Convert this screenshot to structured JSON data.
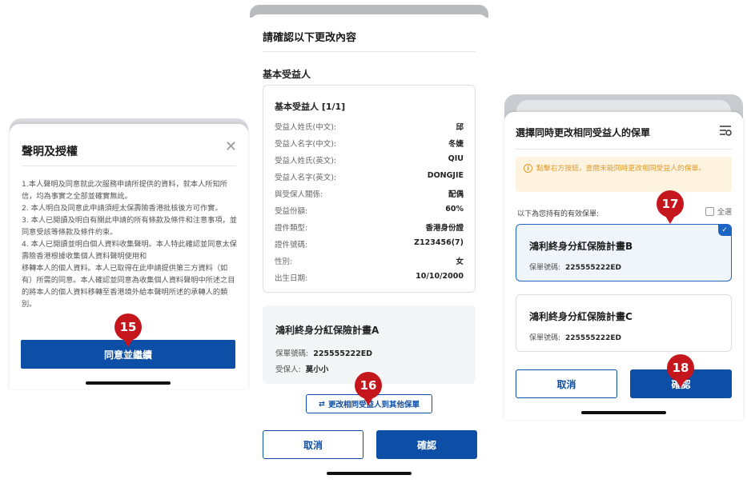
{
  "panel1": {
    "title": "聲明及授權",
    "close_icon": "close-icon",
    "paragraphs": [
      "1.本人聲明及同意就此次服務申請所提供的資料，就本人所知所信，均為事實之全部並確實無訛。",
      "2. 本人明白及同意此申請須經太保壽險香港批核後方可作實。",
      "3. 本人已閱讀及明白有關此申請的所有條款及條件和注意事項，並同意受該等條款及條件約束。",
      "4. 本人已閱讀並明白個人資料收集聲明。本人特此確認並同意太保壽險香港根據收集個人資料聲明使用和",
      "移轉本人的個人資料。本人已取得在此申請提供第三方資料（如有）所需的同意。本人確認並同意為收集個人資料聲明中所述之目的將本人的個人資料移轉至香港境外給本聲明所述的承轉人的類別。"
    ],
    "agree_button": "同意並繼續",
    "step": "15"
  },
  "panel2": {
    "title": "請確認以下更改內容",
    "section_title": "基本受益人",
    "card_title": "基本受益人 [1/1]",
    "fields": [
      {
        "label": "受益人姓氏(中文):",
        "value": "邱"
      },
      {
        "label": "受益人名字(中文):",
        "value": "冬婕"
      },
      {
        "label": "受益人姓氏(英文):",
        "value": "QIU"
      },
      {
        "label": "受益人名字(英文):",
        "value": "DONGJIE"
      },
      {
        "label": "與受保人關係:",
        "value": "配偶"
      },
      {
        "label": "受益份額:",
        "value": "60%"
      },
      {
        "label": "證件類型:",
        "value": "香港身份證"
      },
      {
        "label": "證件號碼:",
        "value": "Z123456(7)"
      },
      {
        "label": "性別:",
        "value": "女"
      },
      {
        "label": "出生日期:",
        "value": "10/10/2000"
      }
    ],
    "plan": {
      "name": "鴻利終身分紅保險計畫A",
      "policy_label": "保單號碼:",
      "policy_no": "225555222ED",
      "insured_label": "受保人:",
      "insured": "莫小小"
    },
    "change_link": "更改相同受益人到其他保單",
    "cancel": "取消",
    "confirm": "確認",
    "step": "16"
  },
  "panel3": {
    "title": "選擇同時更改相同受益人的保單",
    "notice": "點擊右方按鈕，查閱未能同時更改相同受益人的保單。",
    "holding_label": "以下為您持有的有效保單:",
    "select_all": "全選",
    "policies": [
      {
        "name": "鴻利終身分紅保險計畫B",
        "label": "保單號碼:",
        "number": "225555222ED",
        "selected": true
      },
      {
        "name": "鴻利終身分紅保險計畫C",
        "label": "保單號碼:",
        "number": "225555222ED",
        "selected": false
      }
    ],
    "cancel": "取消",
    "confirm": "確認",
    "step17": "17",
    "step18": "18"
  },
  "colors": {
    "primary": "#0d4ea6",
    "step_badge": "#c6161d",
    "notice_bg": "#fdf3de",
    "notice_text": "#e39b2c"
  }
}
